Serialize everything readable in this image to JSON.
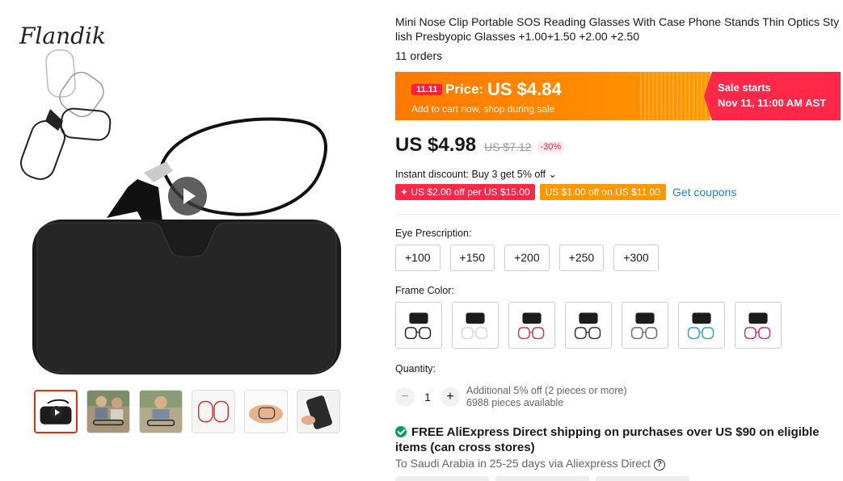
{
  "gallery": {
    "brand": "Flandik",
    "thumbnails": [
      {
        "name": "thumb-video-case",
        "active": true
      },
      {
        "name": "thumb-people-reading"
      },
      {
        "name": "thumb-person-reading"
      },
      {
        "name": "thumb-glasses-red"
      },
      {
        "name": "thumb-hand-holding"
      },
      {
        "name": "thumb-phone-case"
      }
    ]
  },
  "product": {
    "title": "Mini Nose Clip Portable SOS Reading Glasses With Case Phone Stands Thin Optics Stylish Presbyopic Glasses +1.00+1.50 +2.00 +2.50",
    "orders": "11 orders"
  },
  "sale": {
    "tag": "11.11",
    "price_label": "Price:",
    "price": "US $4.84",
    "subtitle": "Add to cart now, shop during sale",
    "starts_label": "Sale starts",
    "starts_date": "Nov 11, 11:00 AM AST",
    "colors": {
      "orange": "#ff8a00",
      "red": "#ff2848"
    }
  },
  "pricing": {
    "price": "US $4.98",
    "original_price": "US $7.12",
    "discount": "-30%"
  },
  "instant_discount": {
    "text": "Instant discount: Buy 3 get 5% off ⌄"
  },
  "coupons": {
    "red": "✦ US $2.00 off per US $15.00",
    "orange": "US $1.00 off on US $11.00",
    "get_coupons": "Get coupons"
  },
  "eye_prescription": {
    "label": "Eye Prescription:",
    "options": [
      "+100",
      "+150",
      "+200",
      "+250",
      "+300"
    ]
  },
  "frame_color": {
    "label": "Frame Color:",
    "swatches": [
      {
        "accent": "#222222"
      },
      {
        "accent": "#cfd8e6"
      },
      {
        "accent": "#d9364a"
      },
      {
        "accent": "#333333"
      },
      {
        "accent": "#6b6b6b"
      },
      {
        "accent": "#2aa3d8"
      },
      {
        "accent": "#c0308c"
      }
    ]
  },
  "quantity": {
    "label": "Quantity:",
    "minus": "−",
    "value": "1",
    "plus": "+",
    "additional": "Additional 5% off (2 pieces or more)",
    "available": "6988 pieces available"
  },
  "shipping": {
    "title": "FREE AliExpress Direct shipping on purchases over US $90 on eligible items (can cross stores)",
    "delivery": "To Saudi Arabia in 25-25 days via Aliexpress Direct",
    "help": "?"
  }
}
